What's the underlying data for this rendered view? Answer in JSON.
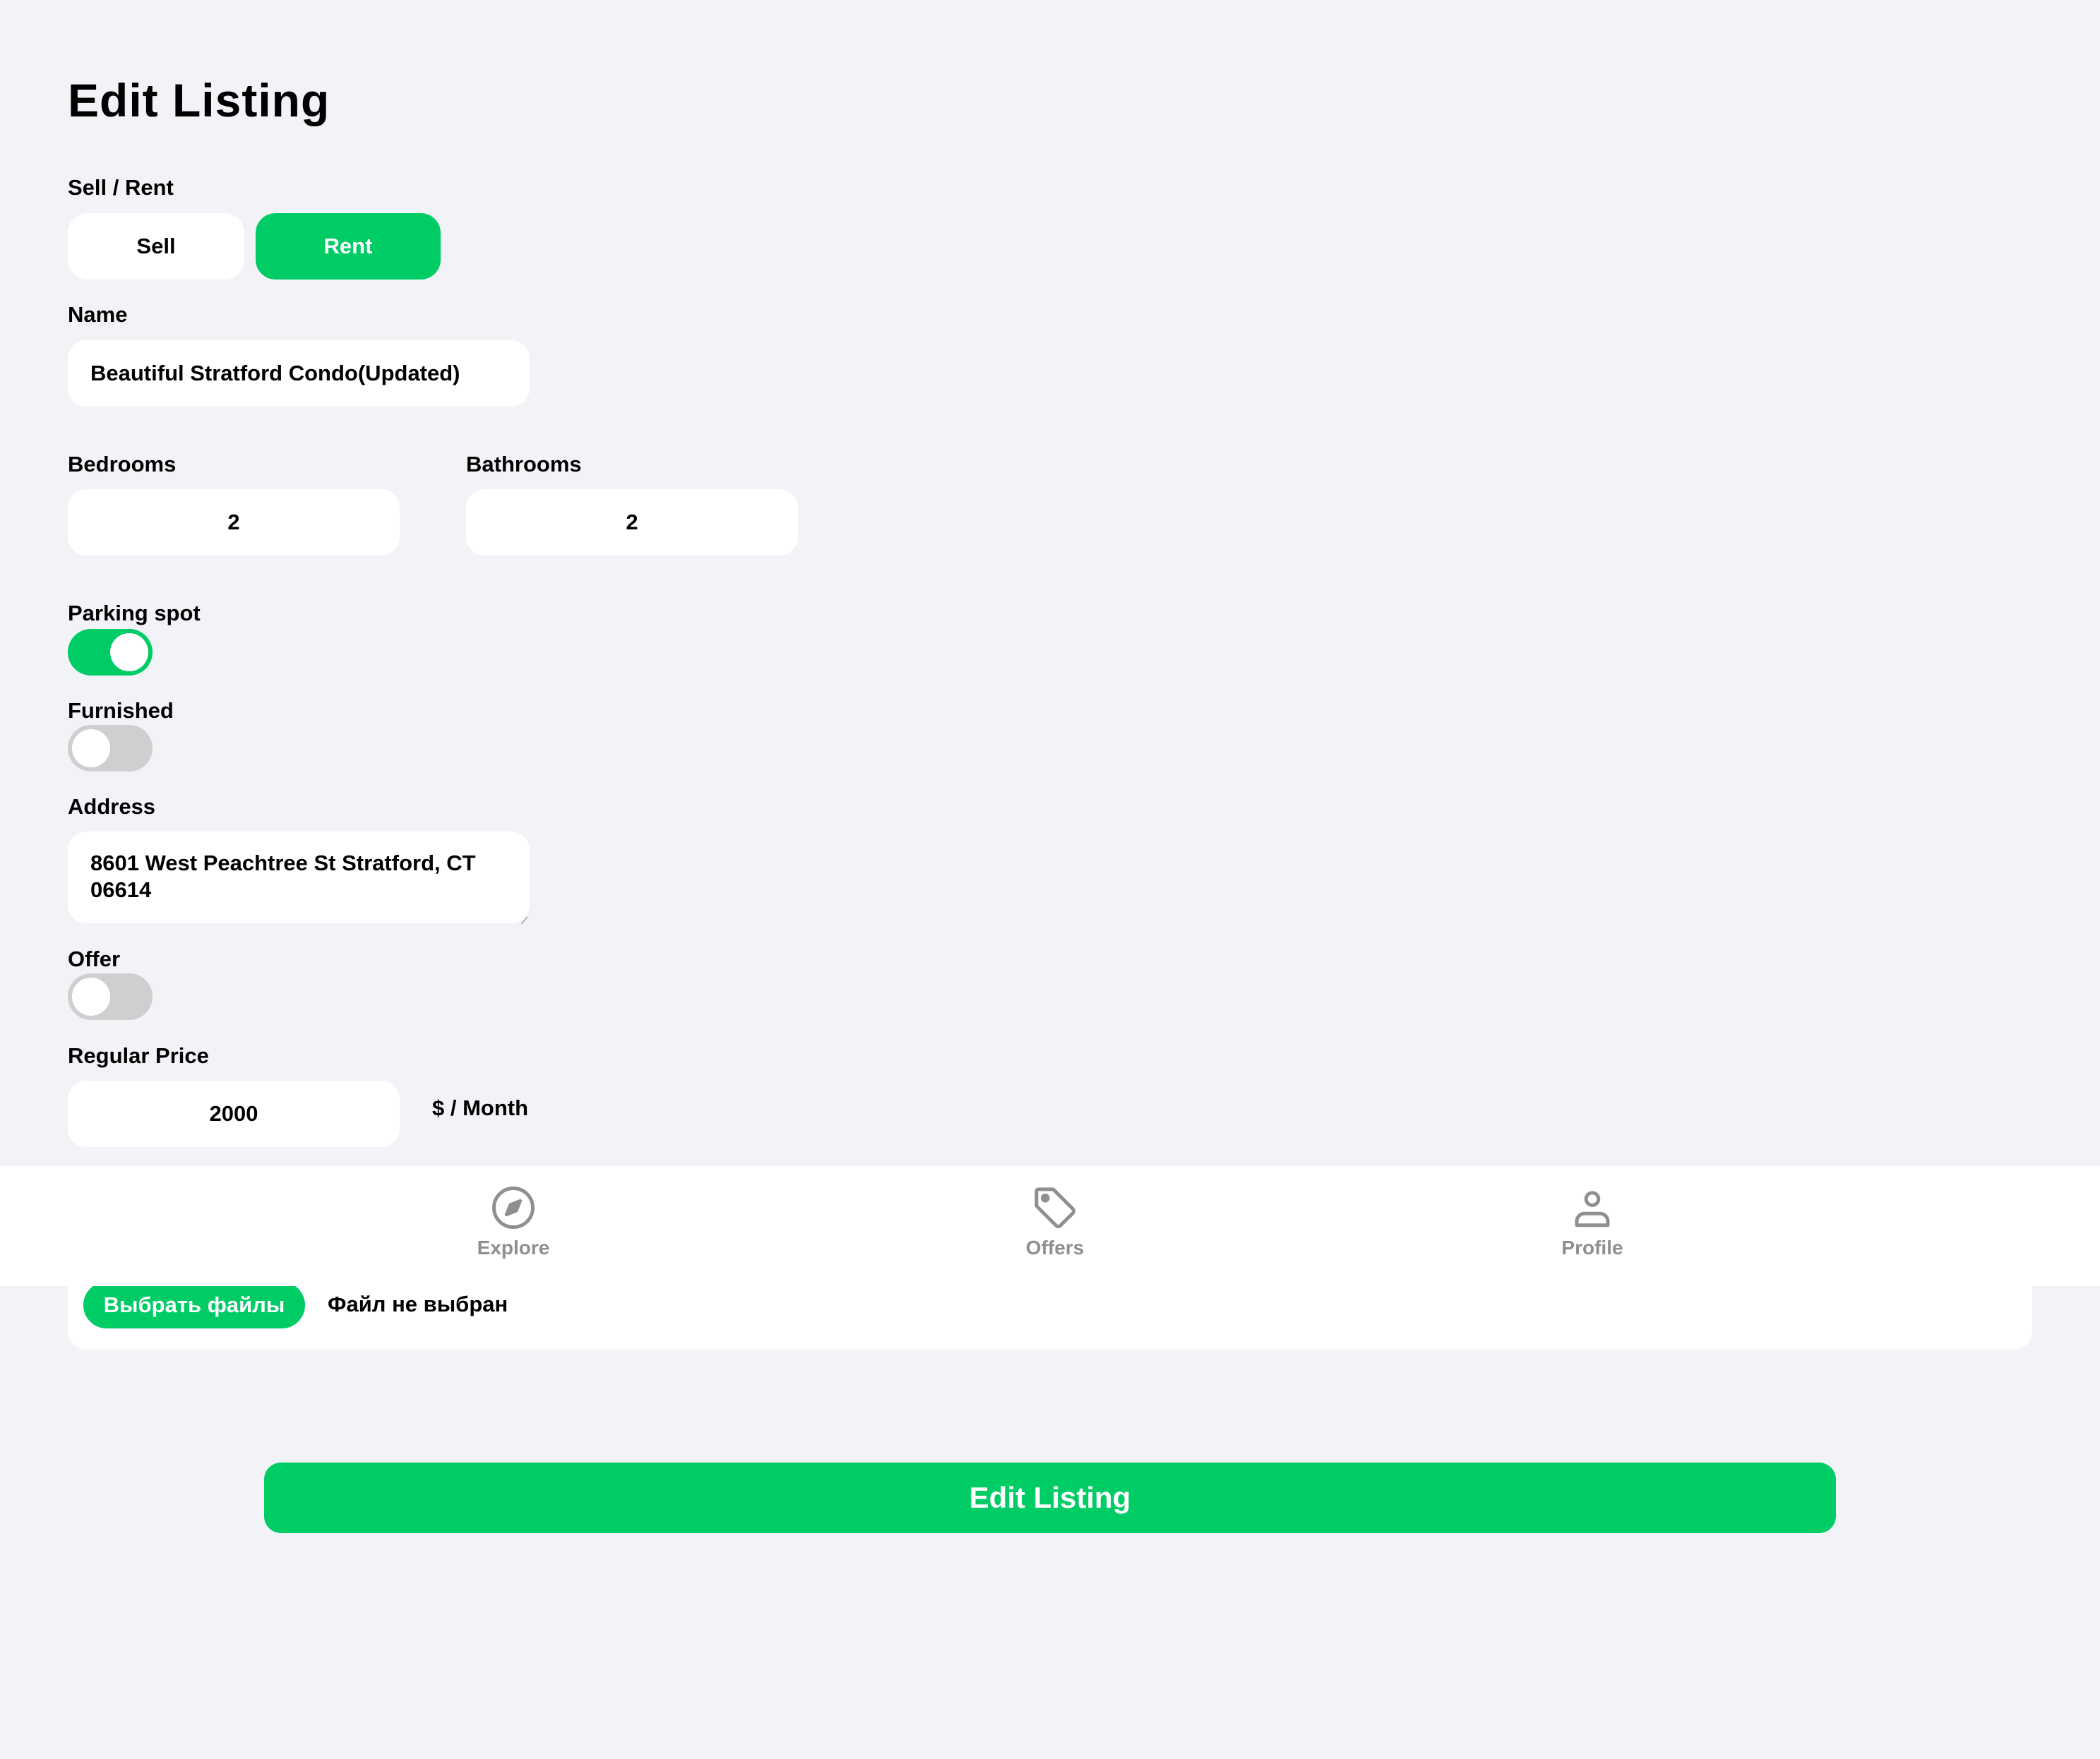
{
  "page": {
    "title": "Edit Listing"
  },
  "type_toggle": {
    "label": "Sell / Rent",
    "sell_label": "Sell",
    "rent_label": "Rent",
    "selected": "Rent"
  },
  "name": {
    "label": "Name",
    "value": "Beautiful Stratford Condo(Updated)"
  },
  "bedrooms": {
    "label": "Bedrooms",
    "value": "2"
  },
  "bathrooms": {
    "label": "Bathrooms",
    "value": "2"
  },
  "parking": {
    "label": "Parking spot",
    "on": true
  },
  "furnished": {
    "label": "Furnished",
    "on": false
  },
  "address": {
    "label": "Address",
    "value": "8601 West Peachtree St Stratford, CT 06614"
  },
  "offer": {
    "label": "Offer",
    "on": false
  },
  "regular_price": {
    "label": "Regular Price",
    "value": "2000",
    "unit": "$ / Month"
  },
  "images": {
    "choose_label": "Выбрать файлы",
    "status": "Файл не выбран"
  },
  "submit": {
    "label": "Edit Listing"
  },
  "navbar": {
    "items": [
      {
        "label": "Explore",
        "icon": "compass-icon"
      },
      {
        "label": "Offers",
        "icon": "tag-icon"
      },
      {
        "label": "Profile",
        "icon": "person-icon"
      }
    ]
  },
  "colors": {
    "accent": "#00cc66",
    "background": "#f2f3f7",
    "toggle_off": "#cfcfcf",
    "nav_inactive": "#8f8f8f"
  }
}
